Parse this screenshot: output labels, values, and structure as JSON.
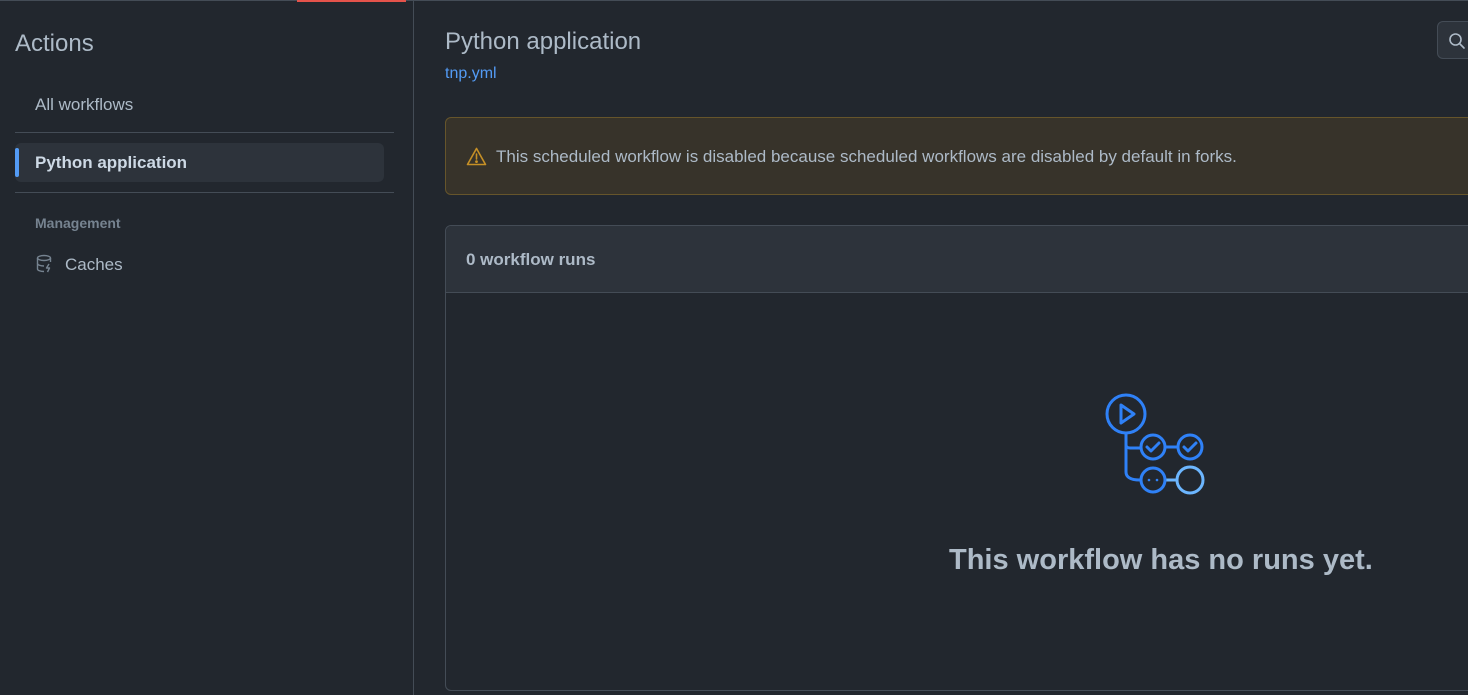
{
  "sidebar": {
    "title": "Actions",
    "all_workflows": "All workflows",
    "selected_workflow": "Python application",
    "management_label": "Management",
    "caches_label": "Caches"
  },
  "main": {
    "title": "Python application",
    "file_link": "tnp.yml",
    "warning": "This scheduled workflow is disabled because scheduled workflows are disabled by default in forks.",
    "runs_count": "0 workflow runs",
    "empty_message": "This workflow has no runs yet."
  },
  "colors": {
    "background": "#22272e",
    "accent": "#539bf5",
    "warning_bg": "#37332a",
    "warning_icon": "#c69026",
    "top_accent": "#e5534b"
  },
  "icons": {
    "caches": "database-icon",
    "search": "search-icon",
    "warning": "alert-icon",
    "empty_state": "workflow-graph-icon"
  }
}
